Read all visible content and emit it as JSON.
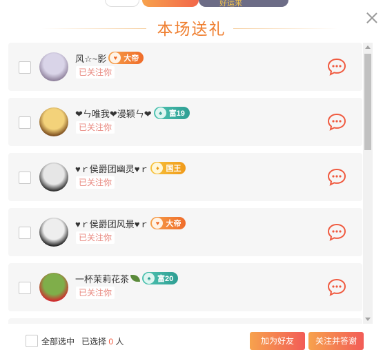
{
  "title": "本场送礼",
  "behind_tab": "好运来",
  "rows": [
    {
      "name": "风☆~影",
      "badge": "大帝",
      "badge_style": "orange",
      "status": "已关注你",
      "avatar_colors": [
        "#d9d4e8",
        "#8d7f9a"
      ]
    },
    {
      "name": "❤ㄣ唯我❤漫颖ㄣ❤",
      "badge": "富19",
      "badge_style": "teal",
      "status": "已关注你",
      "avatar_colors": [
        "#f3d27a",
        "#7a4b1c"
      ]
    },
    {
      "name": "♥ｒ侯爵团幽灵♥ｒ",
      "badge": "国王",
      "badge_style": "gold",
      "status": "已关注你",
      "avatar_colors": [
        "#e6e6e6",
        "#2a2a2a"
      ]
    },
    {
      "name": "♥ｒ侯爵团风景♥ｒ",
      "badge": "大帝",
      "badge_style": "orange",
      "status": "已关注你",
      "avatar_colors": [
        "#eeeeee",
        "#1f1f1f"
      ]
    },
    {
      "name": "一杯茉莉花茶",
      "badge": "富20",
      "badge_style": "teal",
      "status": "已关注你",
      "avatar_colors": [
        "#7fae4a",
        "#d2262c"
      ]
    }
  ],
  "footer": {
    "select_all": "全部选中",
    "selected_prefix": "已选择",
    "selected_count": "0",
    "selected_suffix": "人",
    "add_friend": "加为好友",
    "follow_back": "关注并答谢"
  },
  "colors": {
    "accent": "#ef7e2f",
    "chat_icon": "#f0593e",
    "status_text": "#e8867d"
  }
}
